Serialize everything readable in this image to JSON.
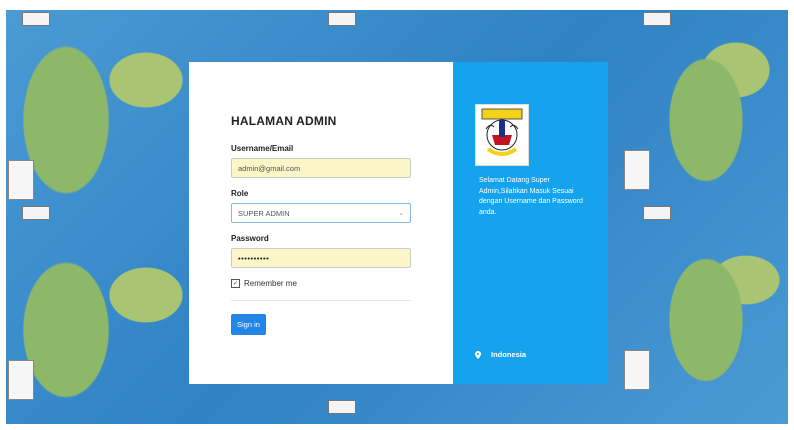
{
  "login": {
    "title": "HALAMAN ADMIN",
    "username_label": "Username/Email",
    "username_value": "admin@gmail.com",
    "role_label": "Role",
    "role_value": "SUPER ADMIN",
    "password_label": "Password",
    "password_value": "••••••••••",
    "remember_label": "Remember me",
    "signin_label": "Sign in"
  },
  "info": {
    "welcome_text": "Selamat Datang Super Admin,Silahkan Masuk Sesuai dengan Username dan Password anda.",
    "location": "Indonesia",
    "location_icon": "map-pin-icon",
    "logo_icon": "emblem-logo"
  },
  "colors": {
    "panel_blue": "#14a3ec",
    "button_blue": "#2286e8",
    "autofill_yellow": "#faf6c8"
  }
}
